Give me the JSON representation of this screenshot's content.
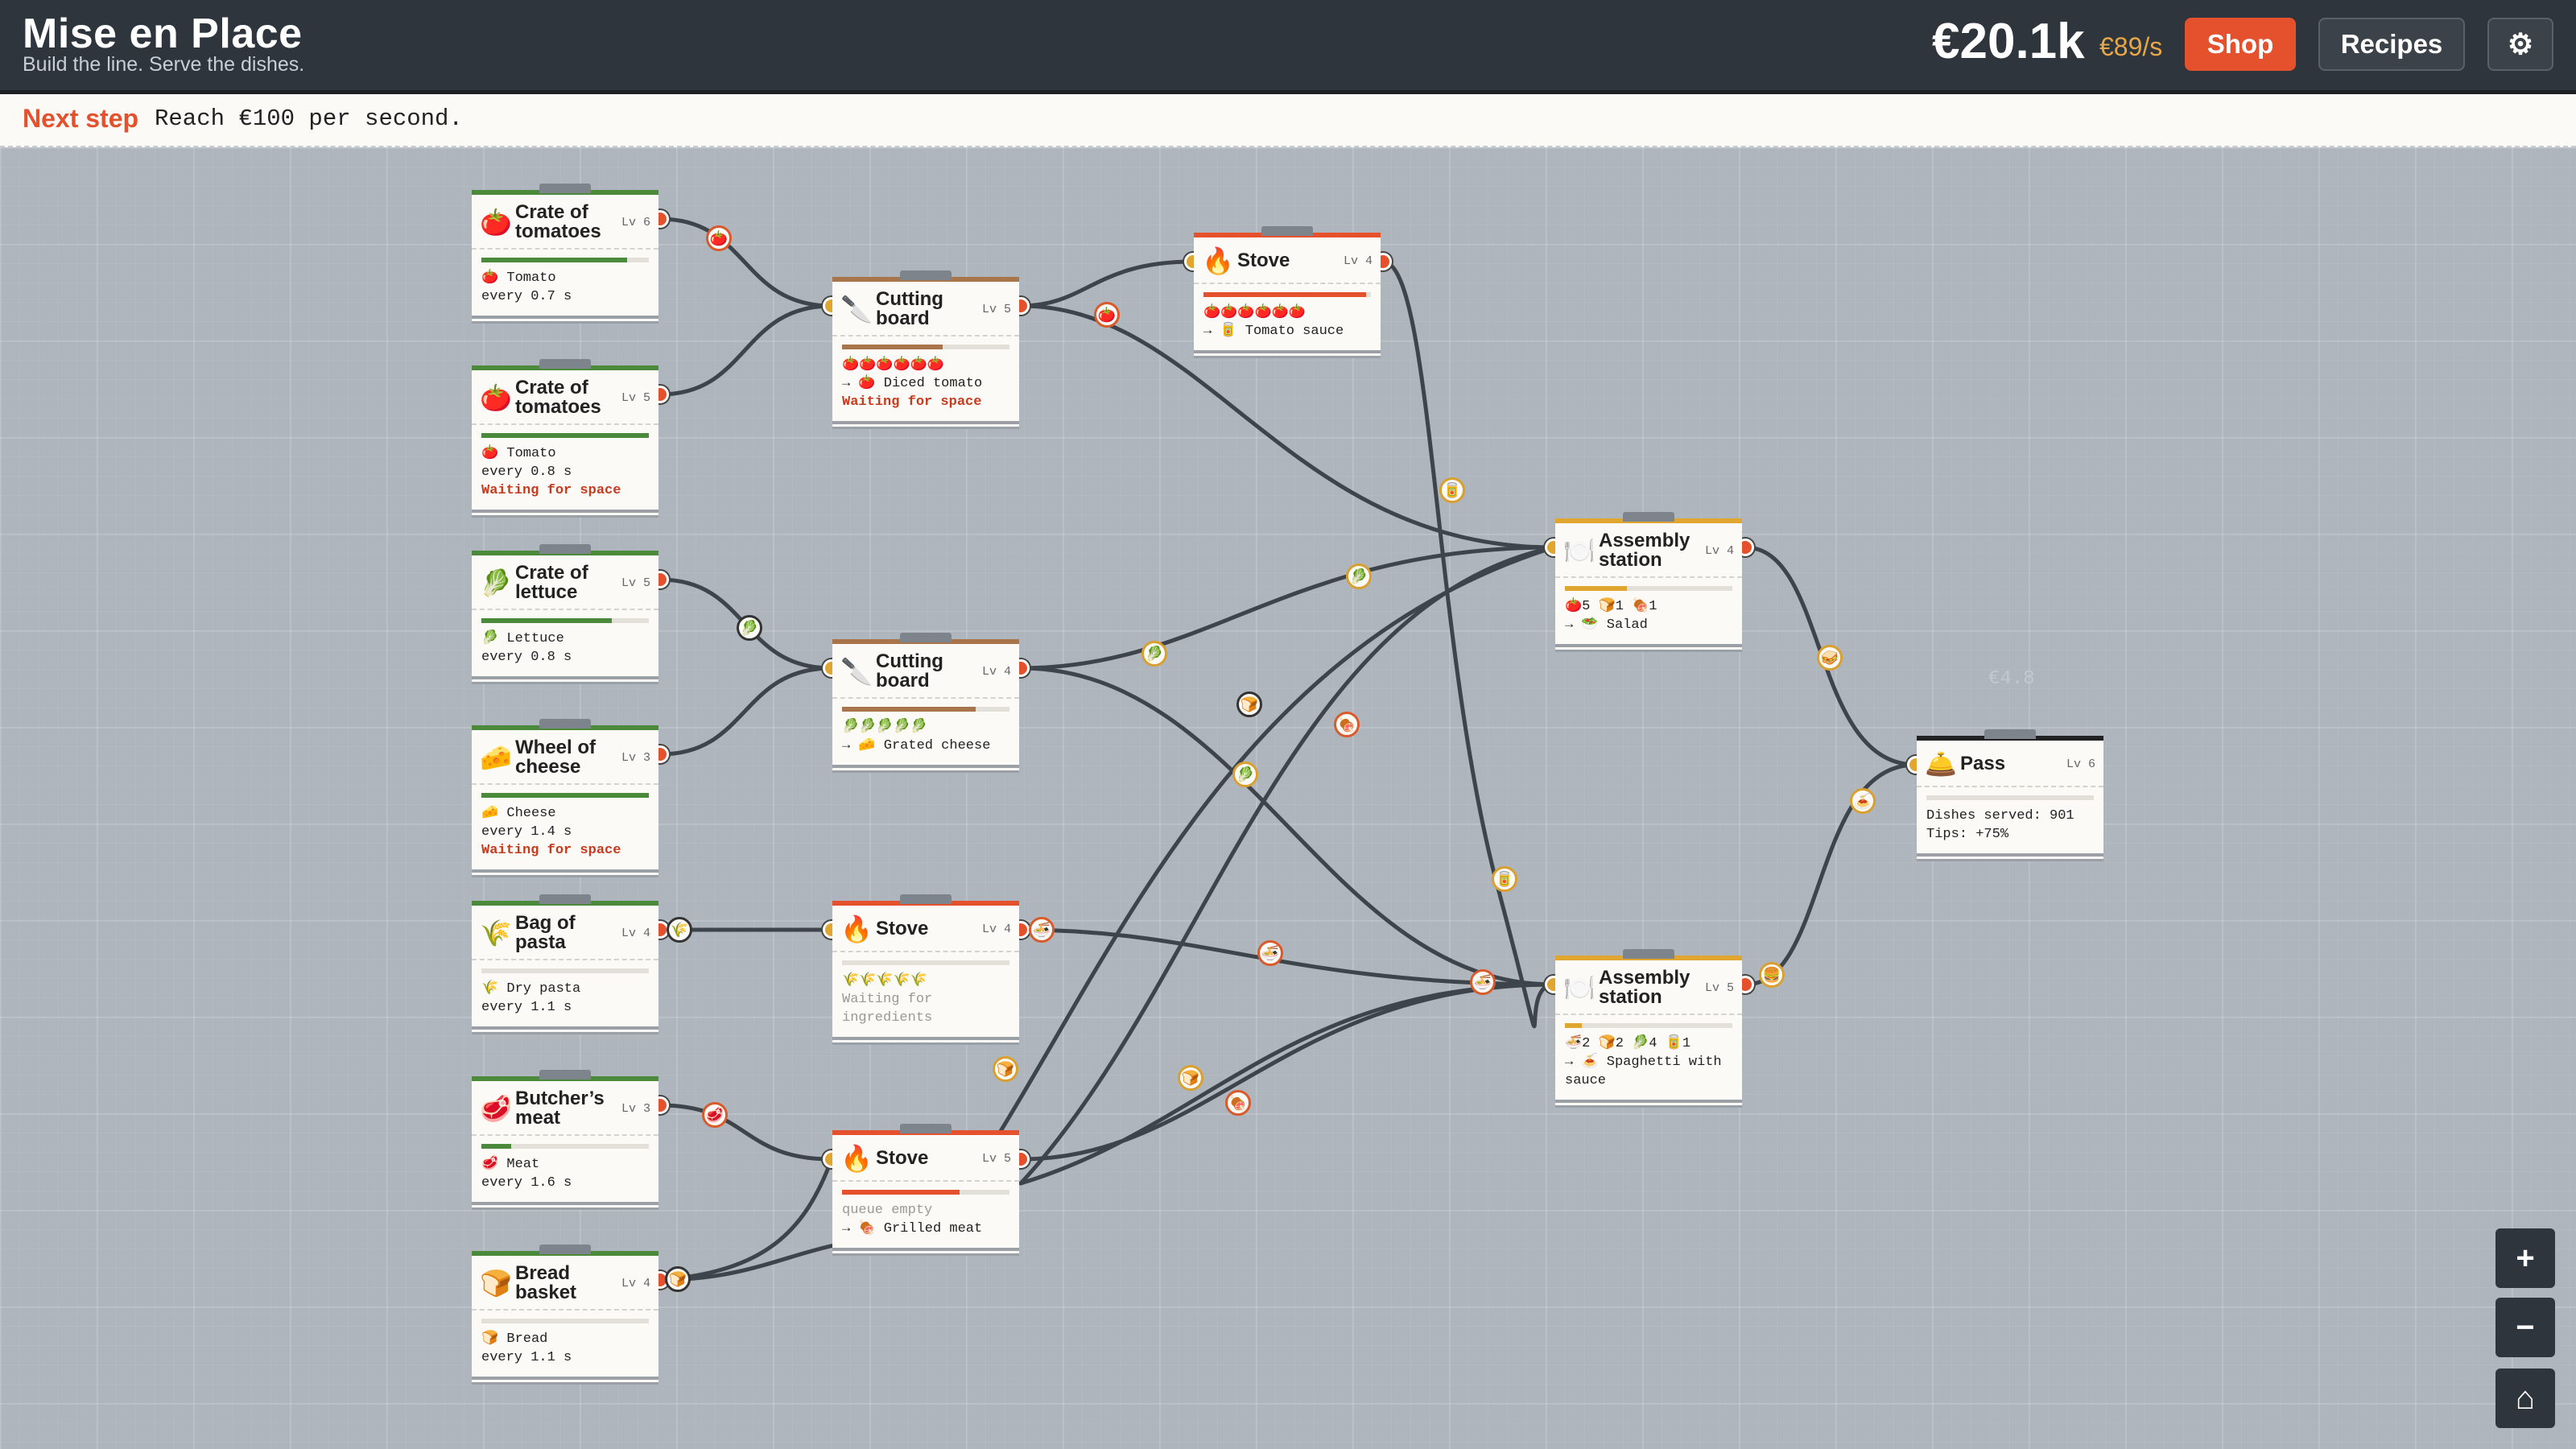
{
  "header": {
    "title": "Mise en Place",
    "subtitle": "Build the line. Serve the dishes.",
    "money": "€20.1k",
    "rate": "€89/s",
    "shop": "Shop",
    "recipes": "Recipes",
    "settings_icon": "⚙"
  },
  "next_step": {
    "label": "Next step",
    "text": "Reach €100 per second."
  },
  "cards": {
    "crate1": {
      "emoji": "🍅",
      "title": "Crate of tomatoes",
      "lv": "Lv 6",
      "line1": "🍅 Tomato",
      "line2": "every 0.7 s",
      "progress": 0.87
    },
    "crate2": {
      "emoji": "🍅",
      "title": "Crate of tomatoes",
      "lv": "Lv 5",
      "line1": "🍅 Tomato",
      "line2": "every 0.8 s",
      "status": "Waiting for space",
      "progress": 1.0
    },
    "lettuce": {
      "emoji": "🥬",
      "title": "Crate of lettuce",
      "lv": "Lv 5",
      "line1": "🥬 Lettuce",
      "line2": "every 0.8 s",
      "progress": 0.78
    },
    "cheese": {
      "emoji": "🧀",
      "title": "Wheel of cheese",
      "lv": "Lv 3",
      "line1": "🧀 Cheese",
      "line2": "every 1.4 s",
      "status": "Waiting for space",
      "progress": 1.0
    },
    "pasta": {
      "emoji": "🌾",
      "title": "Bag of pasta",
      "lv": "Lv 4",
      "line1": "🌾 Dry pasta",
      "line2": "every 1.1 s",
      "progress": 0.0
    },
    "meat": {
      "emoji": "🥩",
      "title": "Butcher’s meat",
      "lv": "Lv 3",
      "line1": "🥩 Meat",
      "line2": "every 1.6 s",
      "progress": 0.18
    },
    "bread": {
      "emoji": "🍞",
      "title": "Bread basket",
      "lv": "Lv 4",
      "line1": "🍞 Bread",
      "line2": "every 1.1 s",
      "progress": 0.0
    },
    "cut1": {
      "emoji": "🔪",
      "title": "Cutting board",
      "lv": "Lv 5",
      "line1": "🍅🍅🍅🍅🍅🍅",
      "line2": "→ 🍅 Diced tomato",
      "status": "Waiting for space",
      "progress": 0.6
    },
    "cut2": {
      "emoji": "🔪",
      "title": "Cutting board",
      "lv": "Lv 4",
      "line1": "🥬🥬🥬🥬🥬",
      "line2": "→ 🧀 Grated cheese",
      "progress": 0.8
    },
    "stove1": {
      "emoji": "🔥",
      "title": "Stove",
      "lv": "Lv 4",
      "line1": "🍅🍅🍅🍅🍅🍅",
      "line2": "→ 🥫 Tomato sauce",
      "progress": 0.97
    },
    "stove2": {
      "emoji": "🔥",
      "title": "Stove",
      "lv": "Lv 4",
      "line1": "🌾🌾🌾🌾🌾",
      "line2": "Waiting for",
      "line3": "ingredients",
      "progress": 0.0
    },
    "stove3": {
      "emoji": "🔥",
      "title": "Stove",
      "lv": "Lv 5",
      "line1": "queue empty",
      "line2": "→ 🍖 Grilled meat",
      "progress": 0.7
    },
    "asm1": {
      "emoji": "🍽️",
      "title": "Assembly station",
      "lv": "Lv 4",
      "line1": "🍅5 🍞1 🍖1",
      "line2": "→ 🥗 Salad",
      "progress": 0.37
    },
    "asm2": {
      "emoji": "🍽️",
      "title": "Assembly station",
      "lv": "Lv 5",
      "line1": "🍜2 🍞2 🥬4 🥫1",
      "line2": "→ 🍝 Spaghetti with",
      "line3": "sauce",
      "progress": 0.1
    },
    "pass": {
      "emoji": "🛎️",
      "title": "Pass",
      "lv": "Lv 6",
      "line1": "Dishes served: 901",
      "line2": "Tips: +75%",
      "progress": 0.0
    }
  },
  "tokens": {
    "t1": "🍅",
    "t2": "🍅",
    "t3": "🥬",
    "t4": "🥬",
    "t5": "🥬",
    "t6": "🥬",
    "t7": "🍞",
    "t8": "🍖",
    "t9": "🥫",
    "t10": "🥫",
    "t11": "🌾",
    "t12": "🍜",
    "t13": "🍜",
    "t14": "🍜",
    "t15": "🥩",
    "t16": "🍞",
    "t17": "🍞",
    "t18": "🍖",
    "t19": "🍞",
    "t20": "🥪",
    "t21": "🍝",
    "t22": "🍔"
  },
  "ghost_text": "€4.8",
  "zoom": {
    "in": "+",
    "out": "−",
    "home": "⌂"
  },
  "colors": {
    "accent": "#e4512c",
    "rate": "#e8a84a",
    "source": "#4a8a3a",
    "cut": "#a8754a",
    "stove": "#e4512c",
    "assembly": "#e0a630",
    "pass": "#222222"
  }
}
